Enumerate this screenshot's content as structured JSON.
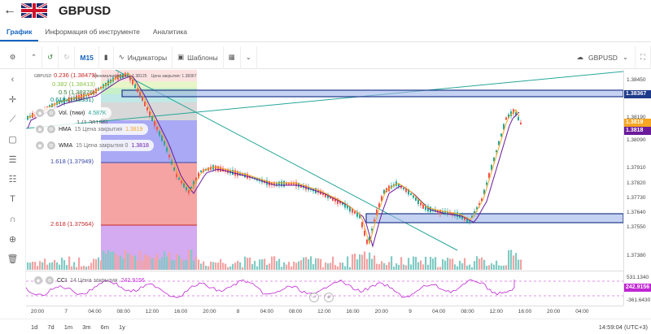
{
  "header": {
    "pair": "GBPUSD"
  },
  "tabs": [
    {
      "label": "График",
      "active": true
    },
    {
      "label": "Информация об инструменте",
      "active": false
    },
    {
      "label": "Аналитика",
      "active": false
    }
  ],
  "toolbar": {
    "interval": "M15",
    "indicators_label": "Индикаторы",
    "templates_label": "Шаблоны",
    "symbol": "GBPUSD"
  },
  "chart": {
    "info_line": {
      "symbol": "GBPUSD",
      "min_price_label": "Минимальная цена:",
      "min_price": "1.38125",
      "close_label": "Цена закрытия:",
      "close": "1.38367"
    },
    "fib_labels": [
      "0.236 (1.38479)",
      "0.382 (1.38413)",
      "0.5 (1.38376)",
      "0.618 (1.38331)",
      "1 (1.38186)",
      "1.618 (1.37949)",
      "2.618 (1.37564)"
    ],
    "legends": {
      "vol": {
        "name": "Vol. (тики)",
        "value": "4.587K"
      },
      "hma": {
        "name": "HMA",
        "params": "15 Цена закрытия",
        "value": "1.3819"
      },
      "wma": {
        "name": "WMA",
        "params": "15 Цена закрытия 0",
        "value": "1.3818"
      }
    },
    "price_axis": [
      "1.38450",
      "1.38190",
      "1.38090",
      "1.37910",
      "1.37820",
      "1.37730",
      "1.37640",
      "1.37550",
      "1.37380"
    ],
    "price_tags": [
      {
        "label": "1.38367",
        "color": "#1e3a8a"
      },
      {
        "label": "1.3819",
        "color": "#f5a623"
      },
      {
        "label": "1.3818",
        "color": "#6a1b9a"
      }
    ],
    "cci": {
      "name": "CCI",
      "params": "14 Цена закрытия",
      "value": "242.9156",
      "axis": [
        "531.1340",
        "242.9156",
        "-361.6430"
      ]
    },
    "time_axis": [
      "20:00",
      "7",
      "04:00",
      "08:00",
      "12:00",
      "16:00",
      "20:00",
      "8",
      "04:00",
      "08:00",
      "12:00",
      "16:00",
      "20:00",
      "9",
      "04:00",
      "08:00",
      "12:00",
      "16:00",
      "20:00",
      "04:00"
    ]
  },
  "bottom": {
    "ranges": [
      "1d",
      "7d",
      "1m",
      "3m",
      "6m",
      "1y"
    ],
    "clock": "14:59:04 (UTC+3)"
  },
  "colors": {
    "accent": "#1565c0",
    "up": "#26a69a",
    "down": "#ef5350",
    "hma": "#f5a623",
    "wma": "#6a1b9a",
    "cci": "#c026d3"
  }
}
